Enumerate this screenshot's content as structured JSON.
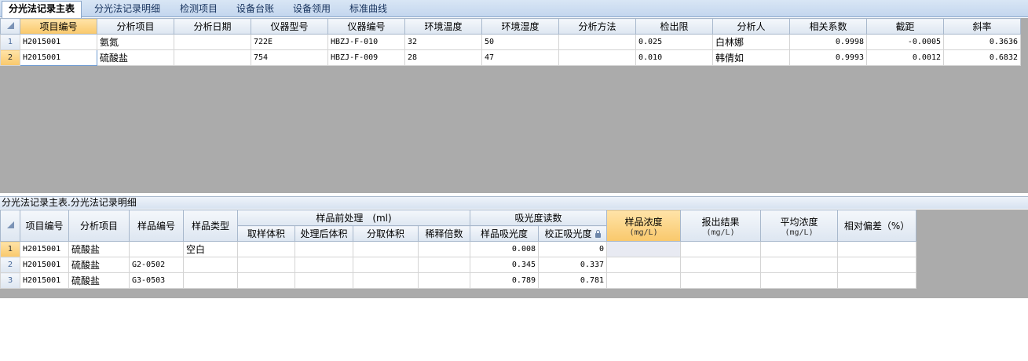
{
  "tabs": [
    "分光法记录主表",
    "分光法记录明细",
    "检测项目",
    "设备台账",
    "设备领用",
    "标准曲线"
  ],
  "master": {
    "columns": [
      "项目编号",
      "分析项目",
      "分析日期",
      "仪器型号",
      "仪器编号",
      "环境温度",
      "环境湿度",
      "分析方法",
      "检出限",
      "分析人",
      "相关系数",
      "截距",
      "斜率"
    ],
    "rows": [
      {
        "no": "1",
        "cells": [
          "H2015001",
          "氨氮",
          "",
          "722E",
          "HBZJ-F-010",
          "32",
          "50",
          "",
          "0.025",
          "白林娜",
          "0.9998",
          "-0.0005",
          "0.3636"
        ]
      },
      {
        "no": "2",
        "cells": [
          "H2015001",
          "硫酸盐",
          "",
          "754",
          "HBZJ-F-009",
          "28",
          "47",
          "",
          "0.010",
          "韩倩如",
          "0.9993",
          "0.0012",
          "0.6832"
        ]
      }
    ]
  },
  "detail": {
    "caption": "分光法记录主表.分光法记录明细",
    "headers": {
      "project_no": "项目编号",
      "analysis_item": "分析项目",
      "sample_no": "样品编号",
      "sample_type": "样品类型",
      "pretreatment_group": "样品前处理　(ml)",
      "sample_volume": "取样体积",
      "processed_volume": "处理后体积",
      "aliquot_volume": "分取体积",
      "dilution_factor": "稀释倍数",
      "absorbance_group": "吸光度读数",
      "sample_absorbance": "样品吸光度",
      "corrected_absorbance": "校正吸光度",
      "sample_concentration": "样品浓度",
      "sample_concentration_unit": "(mg/L)",
      "reported_result": "报出结果",
      "reported_result_unit": "(mg/L)",
      "average_concentration": "平均浓度",
      "average_concentration_unit": "(mg/L)",
      "relative_deviation": "相对偏差（%）"
    },
    "rows": [
      {
        "no": "1",
        "cells": [
          "H2015001",
          "硫酸盐",
          "",
          "空白",
          "",
          "",
          "",
          "",
          "0.008",
          "0",
          "",
          "",
          "",
          ""
        ]
      },
      {
        "no": "2",
        "cells": [
          "H2015001",
          "硫酸盐",
          "G2-0502",
          "",
          "",
          "",
          "",
          "",
          "0.345",
          "0.337",
          "",
          "",
          "",
          ""
        ]
      },
      {
        "no": "3",
        "cells": [
          "H2015001",
          "硫酸盐",
          "G3-0503",
          "",
          "",
          "",
          "",
          "",
          "0.789",
          "0.781",
          "",
          "",
          "",
          ""
        ]
      }
    ]
  }
}
